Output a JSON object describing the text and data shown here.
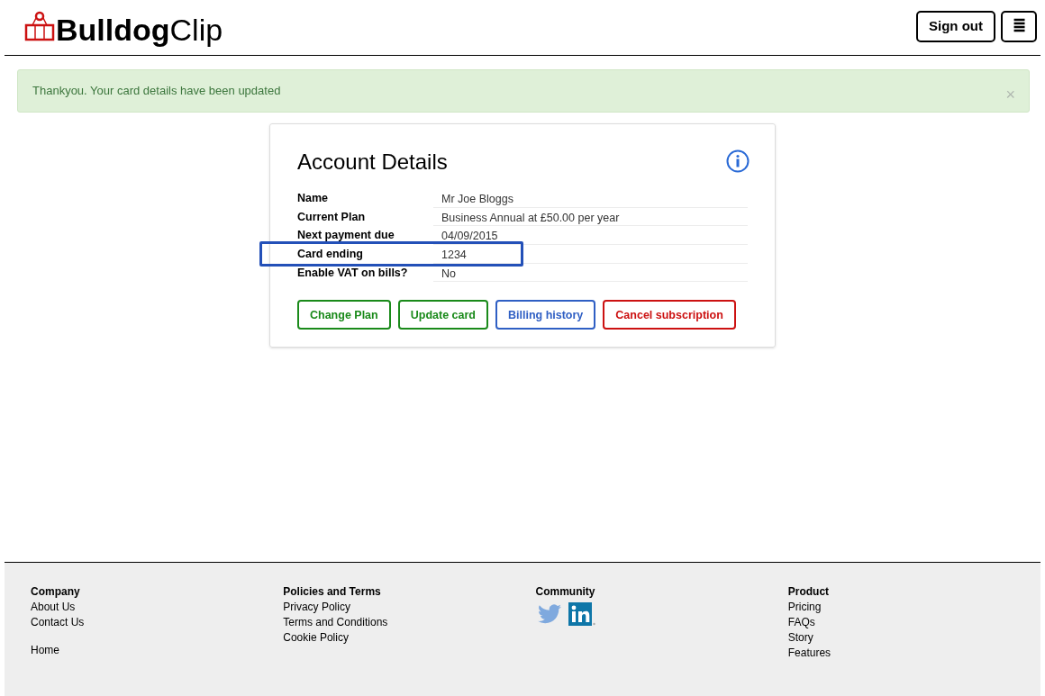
{
  "header": {
    "logo": {
      "bold": "Bulldog",
      "light": "Clip"
    },
    "buttons": [
      {
        "kind": "text",
        "label": "Sign out"
      },
      {
        "kind": "menu",
        "label": "≣"
      }
    ]
  },
  "alert": {
    "message": "Thankyou. Your card details have been updated",
    "close": "×"
  },
  "card": {
    "title": "Account Details",
    "rows": [
      {
        "label": "Name",
        "value": "Mr Joe Bloggs",
        "highlighted": false
      },
      {
        "label": "Current Plan",
        "value": "Business Annual at £50.00 per year",
        "highlighted": false
      },
      {
        "label": "Next payment due",
        "value": "04/09/2015",
        "highlighted": false
      },
      {
        "label": "Card ending",
        "value": "1234",
        "highlighted": true
      },
      {
        "label": "Enable VAT on bills?",
        "value": "No",
        "highlighted": false
      }
    ],
    "buttons": [
      {
        "label": "Change Plan",
        "color": "#1a8a1a"
      },
      {
        "label": "Update card",
        "color": "#1a8a1a"
      },
      {
        "label": "Billing history",
        "color": "#2f5fc4"
      },
      {
        "label": "Cancel subscription",
        "color": "#cc1111"
      }
    ]
  },
  "footer": {
    "columns": [
      {
        "heading": "Company",
        "links": [
          "About Us",
          "Contact Us"
        ],
        "extra": "Home"
      },
      {
        "heading": "Policies and Terms",
        "links": [
          "Privacy Policy",
          "Terms and Conditions",
          "Cookie Policy"
        ]
      },
      {
        "heading": "Community",
        "social": [
          {
            "kind": "twitter"
          },
          {
            "kind": "linkedin"
          }
        ]
      },
      {
        "heading": "Product",
        "links": [
          "Pricing",
          "FAQs",
          "Story",
          "Features"
        ]
      }
    ]
  }
}
